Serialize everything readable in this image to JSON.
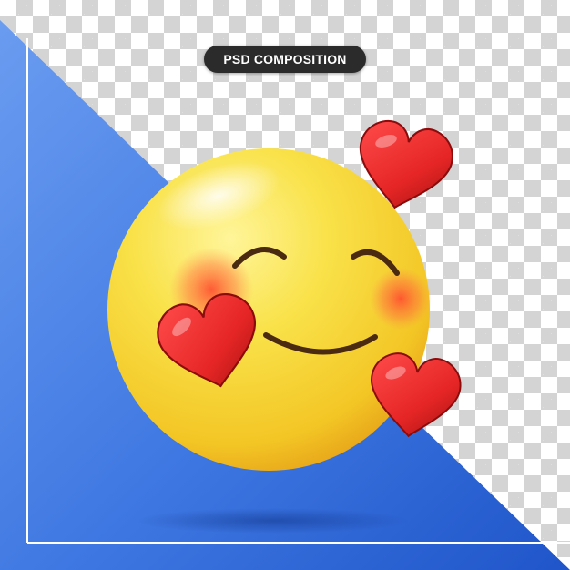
{
  "badge": {
    "label": "PSD COMPOSITION"
  },
  "colors": {
    "transparency_checker_light": "#ffffff",
    "transparency_checker_dark": "#d4d4d4",
    "backdrop_blue_light": "#5b8fe6",
    "backdrop_blue_dark": "#1f55c9",
    "frame_line": "#ffffff",
    "emoji_yellow": "#f7d536",
    "emoji_orange_edge": "#e08f12",
    "cheek_blush": "#ff5a3c",
    "heart_red": "#e62626",
    "face_feature_dark": "#4a2a10",
    "badge_background": "#2b2b2b"
  },
  "illustration": {
    "subject": "smiling-face-with-hearts-emoji",
    "heart_count": 3
  }
}
